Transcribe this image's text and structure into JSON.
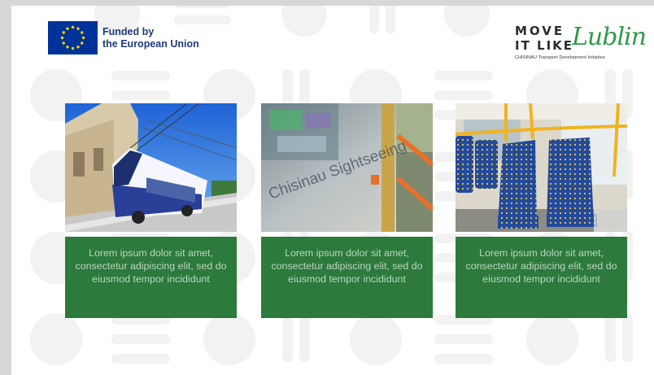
{
  "eu": {
    "line1": "Funded by",
    "line2": "the European Union",
    "icon": "eu-flag-icon"
  },
  "logo": {
    "line1": "MOVE",
    "line2": "IT LIKE",
    "script": "Lublin",
    "tagline": "CHISINAU Transport Development Initiative"
  },
  "cards": [
    {
      "image": "trolleybus-photo",
      "caption": "Lorem ipsum dolor sit amet, consectetur adipiscing elit, sed do eiusmod tempor incididunt"
    },
    {
      "image": "sightseeing-window-photo",
      "sign_text": "Chisinau Sightseeing",
      "caption": "Lorem ipsum dolor sit amet, consectetur adipiscing elit, sed do eiusmod tempor incididunt"
    },
    {
      "image": "bus-seats-photo",
      "caption": "Lorem ipsum dolor sit amet, consectetur adipiscing elit, sed do eiusmod tempor incididunt"
    }
  ],
  "colors": {
    "eu_blue": "#003399",
    "eu_star": "#ffcc00",
    "text_blue": "#1f3b7a",
    "caption_green": "#2c7a3c",
    "brand_green": "#2e9a48",
    "seat_blue": "#234a9c",
    "rail_yellow": "#f0b320",
    "rail_orange": "#e8702a"
  }
}
